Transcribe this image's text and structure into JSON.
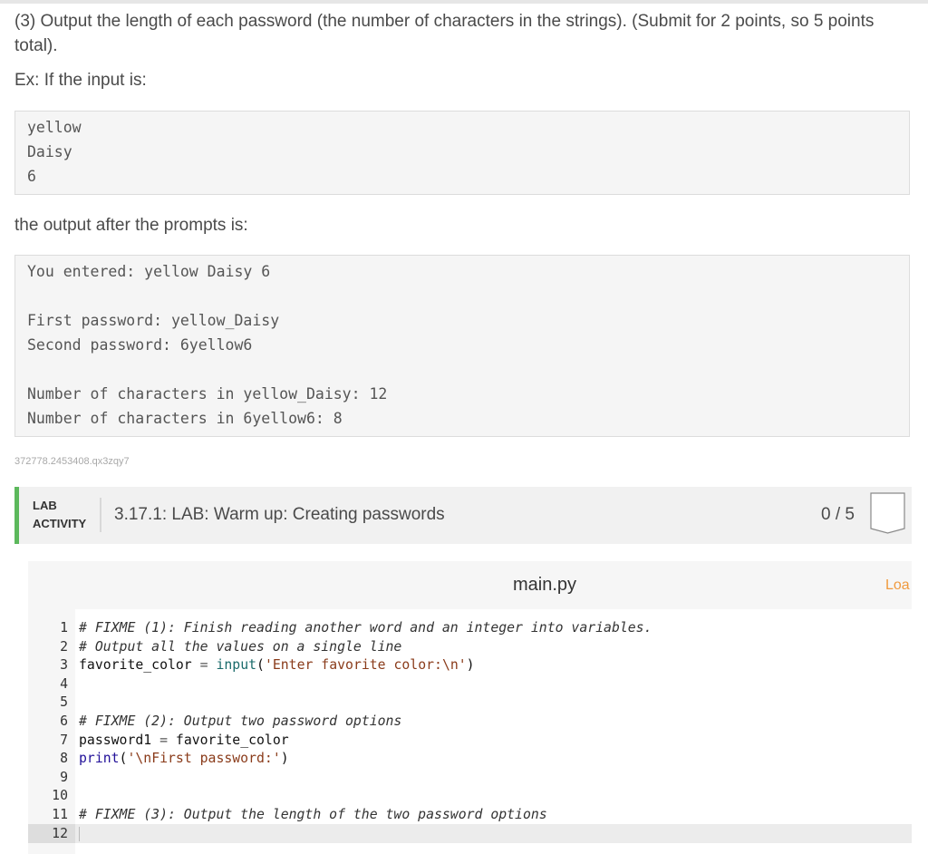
{
  "instructions": {
    "part3": "(3) Output the length of each password (the number of characters in the strings). (Submit for 2 points, so 5 points total).",
    "example_label": "Ex: If the input is:",
    "input_lines": [
      "yellow",
      "Daisy",
      "6"
    ],
    "after_label": "the output after the prompts is:",
    "output_lines": [
      "You entered: yellow Daisy 6",
      "",
      "First password: yellow_Daisy",
      "Second password: 6yellow6",
      "",
      "Number of characters in yellow_Daisy: 12",
      "Number of characters in 6yellow6: 8"
    ],
    "reference_id": "372778.2453408.qx3zqy7"
  },
  "lab": {
    "tag_line1": "LAB",
    "tag_line2": "ACTIVITY",
    "title": "3.17.1: LAB: Warm up: Creating passwords",
    "score": "0 / 5",
    "accent_color": "#5cb85c"
  },
  "editor": {
    "filename": "main.py",
    "load_link": "Loa",
    "active_line": 12,
    "lines": [
      {
        "num": "1",
        "text": "# FIXME (1): Finish reading another word and an integer into variables."
      },
      {
        "num": "2",
        "text": "# Output all the values on a single line"
      },
      {
        "num": "3",
        "text": "favorite_color = input('Enter favorite color:\\n')"
      },
      {
        "num": "4",
        "text": ""
      },
      {
        "num": "5",
        "text": ""
      },
      {
        "num": "6",
        "text": "# FIXME (2): Output two password options"
      },
      {
        "num": "7",
        "text": "password1 = favorite_color"
      },
      {
        "num": "8",
        "text": "print('\\nFirst password:')"
      },
      {
        "num": "9",
        "text": ""
      },
      {
        "num": "10",
        "text": ""
      },
      {
        "num": "11",
        "text": "# FIXME (3): Output the length of the two password options"
      },
      {
        "num": "12",
        "text": ""
      }
    ]
  }
}
